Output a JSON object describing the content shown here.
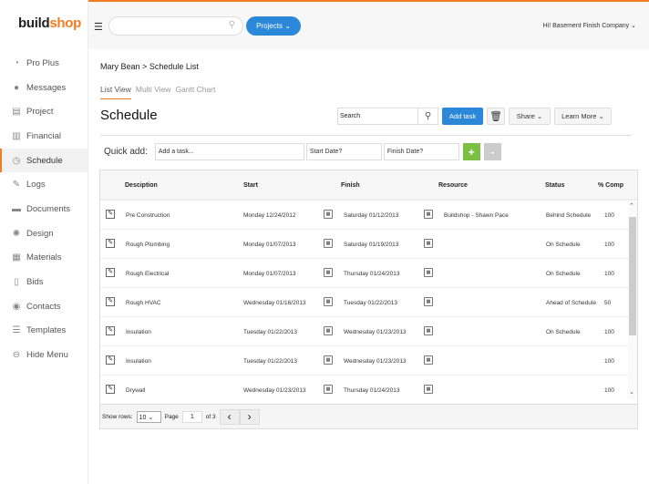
{
  "brand": {
    "part1": "build",
    "part2": "shop",
    "accent": "#f47b20"
  },
  "sidebar": {
    "items": [
      {
        "label": "Pro Plus",
        "icon": "pie-chart-icon",
        "glyph": "◔"
      },
      {
        "label": "Messages",
        "icon": "chat-bubble-icon",
        "glyph": "●"
      },
      {
        "label": "Project",
        "icon": "book-icon",
        "glyph": "▤"
      },
      {
        "label": "Financial",
        "icon": "bar-chart-icon",
        "glyph": "▥"
      },
      {
        "label": "Schedule",
        "icon": "clock-icon",
        "glyph": "◷",
        "active": true
      },
      {
        "label": "Logs",
        "icon": "pencil-icon",
        "glyph": "✎"
      },
      {
        "label": "Documents",
        "icon": "folder-icon",
        "glyph": "▬"
      },
      {
        "label": "Design",
        "icon": "spinner-icon",
        "glyph": "✺"
      },
      {
        "label": "Materials",
        "icon": "layers-icon",
        "glyph": "▦"
      },
      {
        "label": "Bids",
        "icon": "document-icon",
        "glyph": "▯"
      },
      {
        "label": "Contacts",
        "icon": "contact-icon",
        "glyph": "◉"
      },
      {
        "label": "Templates",
        "icon": "list-icon",
        "glyph": "☰"
      },
      {
        "label": "Hide Menu",
        "icon": "arrow-left-icon",
        "glyph": "⊖"
      }
    ]
  },
  "topbar": {
    "projects_label": "Projects ⌄",
    "greeting": "Hi! Basement Finish Company ⌄"
  },
  "breadcrumb": {
    "parent": "Mary Bean",
    "sep": ">",
    "current": "Schedule List"
  },
  "tabs": [
    "List View",
    "Multi View",
    "Gantt Chart"
  ],
  "page_title": "Schedule",
  "toolbar": {
    "search_placeholder": "Search",
    "add_task": "Add task",
    "share": "Share ⌄",
    "learn_more": "Learn More ⌄"
  },
  "quick_add": {
    "label": "Quick add:",
    "task_placeholder": "Add a task...",
    "start_placeholder": "Start Date?",
    "finish_placeholder": "Finish Date?",
    "add": "+",
    "remove": "-"
  },
  "table": {
    "headers": [
      "Desciption",
      "Start",
      "Finish",
      "Resource",
      "Status",
      "% Comp"
    ],
    "rows": [
      {
        "desc": "Pre Construction",
        "start": "Monday 12/24/2012",
        "finish": "Saturday 01/12/2013",
        "resource": "Buildshop - Shawn Pace",
        "status": "Behind Schedule",
        "comp": "100"
      },
      {
        "desc": "Rough Plumbing",
        "start": "Monday 01/07/2013",
        "finish": "Saturday 01/19/2013",
        "resource": "",
        "status": "On Schedule",
        "comp": "100"
      },
      {
        "desc": "Rough Electrical",
        "start": "Monday 01/07/2013",
        "finish": "Thursday 01/24/2013",
        "resource": "",
        "status": "On Schedule",
        "comp": "100"
      },
      {
        "desc": "Rough HVAC",
        "start": "Wednesday 01/16/2013",
        "finish": "Tuesday 01/22/2013",
        "resource": "",
        "status": "Ahead of Schedule",
        "comp": "50"
      },
      {
        "desc": "Insulation",
        "start": "Tuesday 01/22/2013",
        "finish": "Wednesday 01/23/2013",
        "resource": "",
        "status": "On Schedule",
        "comp": "100"
      },
      {
        "desc": "Insulation",
        "start": "Tuesday 01/22/2013",
        "finish": "Wednesday 01/23/2013",
        "resource": "",
        "status": "",
        "comp": "100"
      },
      {
        "desc": "Drywall",
        "start": "Wednesday 01/23/2013",
        "finish": "Thursday 01/24/2013",
        "resource": "",
        "status": "",
        "comp": "100"
      }
    ]
  },
  "pager": {
    "show_rows_label": "Show rows:",
    "rows_value": "10",
    "page_label": "Page",
    "page": "1",
    "of": "of 3"
  }
}
